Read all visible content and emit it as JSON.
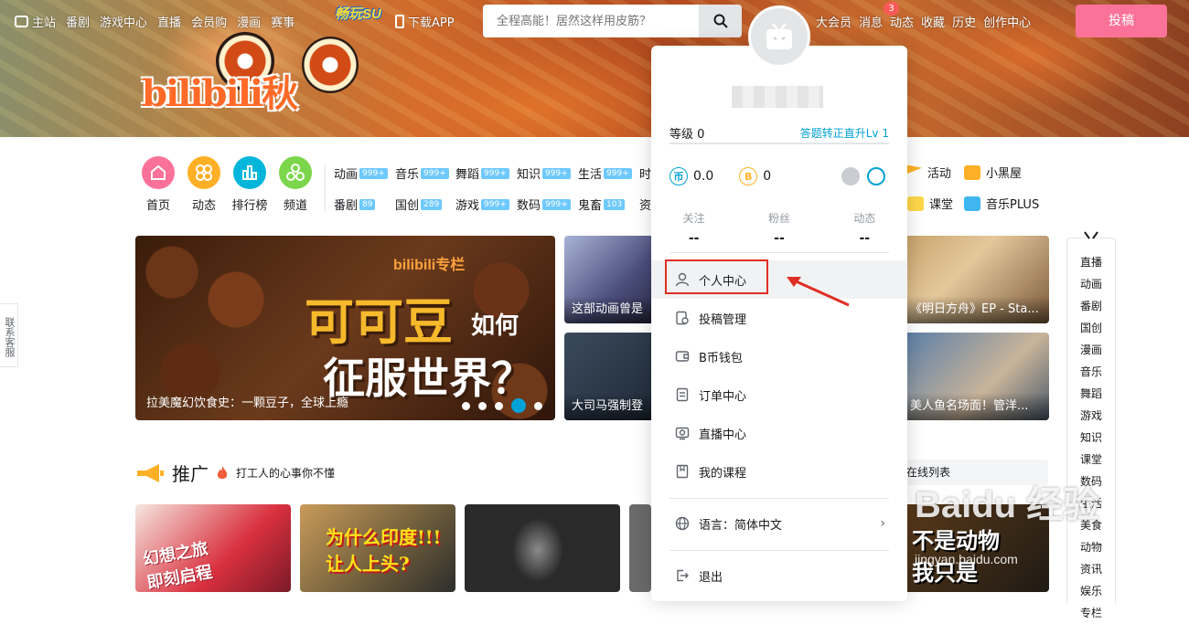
{
  "nav": {
    "left": [
      "主站",
      "番剧",
      "游戏中心",
      "直播",
      "会员购",
      "漫画",
      "赛事"
    ],
    "changwan": "畅玩SU",
    "download": "下载APP",
    "right": [
      "大会员",
      "消息",
      "动态",
      "收藏",
      "历史",
      "创作中心"
    ],
    "message_badge": "3",
    "upload": "投稿"
  },
  "search": {
    "placeholder": "全程高能！居然这样用皮筋？"
  },
  "banner": {
    "logo": "bilibili秋"
  },
  "quick_icons": [
    {
      "label": "首页",
      "color": "#fb7299",
      "icon": "home-icon"
    },
    {
      "label": "动态",
      "color": "#ffb027",
      "icon": "pinwheel-icon"
    },
    {
      "label": "排行榜",
      "color": "#02b5da",
      "icon": "ranking-icon"
    },
    {
      "label": "频道",
      "color": "#7bd64b",
      "icon": "channel-icon"
    }
  ],
  "categories_row1": [
    {
      "name": "动画",
      "count": "999+"
    },
    {
      "name": "音乐",
      "count": "999+"
    },
    {
      "name": "舞蹈",
      "count": "999+"
    },
    {
      "name": "知识",
      "count": "999+"
    },
    {
      "name": "生活",
      "count": "999+"
    },
    {
      "name": "时",
      "count": ""
    }
  ],
  "categories_row2": [
    {
      "name": "番剧",
      "count": "89"
    },
    {
      "name": "国创",
      "count": "289"
    },
    {
      "name": "游戏",
      "count": "999+"
    },
    {
      "name": "数码",
      "count": "999+"
    },
    {
      "name": "鬼畜",
      "count": "103"
    },
    {
      "name": "资",
      "count": ""
    }
  ],
  "categories_right": [
    {
      "name": "活动",
      "icon": "flag-icon"
    },
    {
      "name": "小黑屋",
      "icon": "scales-icon"
    },
    {
      "name": "课堂",
      "icon": "class-icon"
    },
    {
      "name": "音乐PLUS",
      "icon": "music-plus-icon"
    }
  ],
  "carousel": {
    "tag": "bilibili专栏",
    "big1": "可可豆",
    "small": "如何",
    "big2": "征服世界？",
    "title": "拉美魔幻饮食史：一颗豆子，全球上瘾"
  },
  "thumbs": [
    {
      "caption": "这部动画曾是"
    },
    {
      "caption": "大司马强制登"
    },
    {
      "caption": "《明日方舟》EP - Sta..."
    },
    {
      "caption": "美人鱼名场面！管洋..."
    }
  ],
  "promo": {
    "title": "推广",
    "subtitle": "打工人的心事你不懂"
  },
  "online_list": "在线列表",
  "sidebar": [
    "直播",
    "动画",
    "番剧",
    "国创",
    "漫画",
    "音乐",
    "舞蹈",
    "游戏",
    "知识",
    "课堂",
    "数码",
    "生活",
    "美食",
    "动物",
    "资讯",
    "娱乐",
    "专栏"
  ],
  "kefu": "联系客服",
  "dropdown": {
    "level_label": "等级 0",
    "level_link": "答题转正直升Lv 1",
    "coin1": "0.0",
    "coin2": "0",
    "stats": [
      {
        "label": "关注",
        "value": "--"
      },
      {
        "label": "粉丝",
        "value": "--"
      },
      {
        "label": "动态",
        "value": "--"
      }
    ],
    "menu": [
      {
        "label": "个人中心",
        "icon": "user-icon"
      },
      {
        "label": "投稿管理",
        "icon": "upload-manage-icon"
      },
      {
        "label": "B币钱包",
        "icon": "wallet-icon"
      },
      {
        "label": "订单中心",
        "icon": "order-icon"
      },
      {
        "label": "直播中心",
        "icon": "live-icon"
      },
      {
        "label": "我的课程",
        "icon": "course-icon"
      }
    ],
    "language": "语言：简体中文",
    "logout": "退出"
  },
  "watermark": {
    "main": "Baidu 经验",
    "sub": "jingyan.baidu.com"
  },
  "video_overlays": {
    "v1": "幻想之旅\n即刻启程",
    "v2": "为什么印度!!!\n让人上头?",
    "v3": "不是动物\n我只是"
  }
}
